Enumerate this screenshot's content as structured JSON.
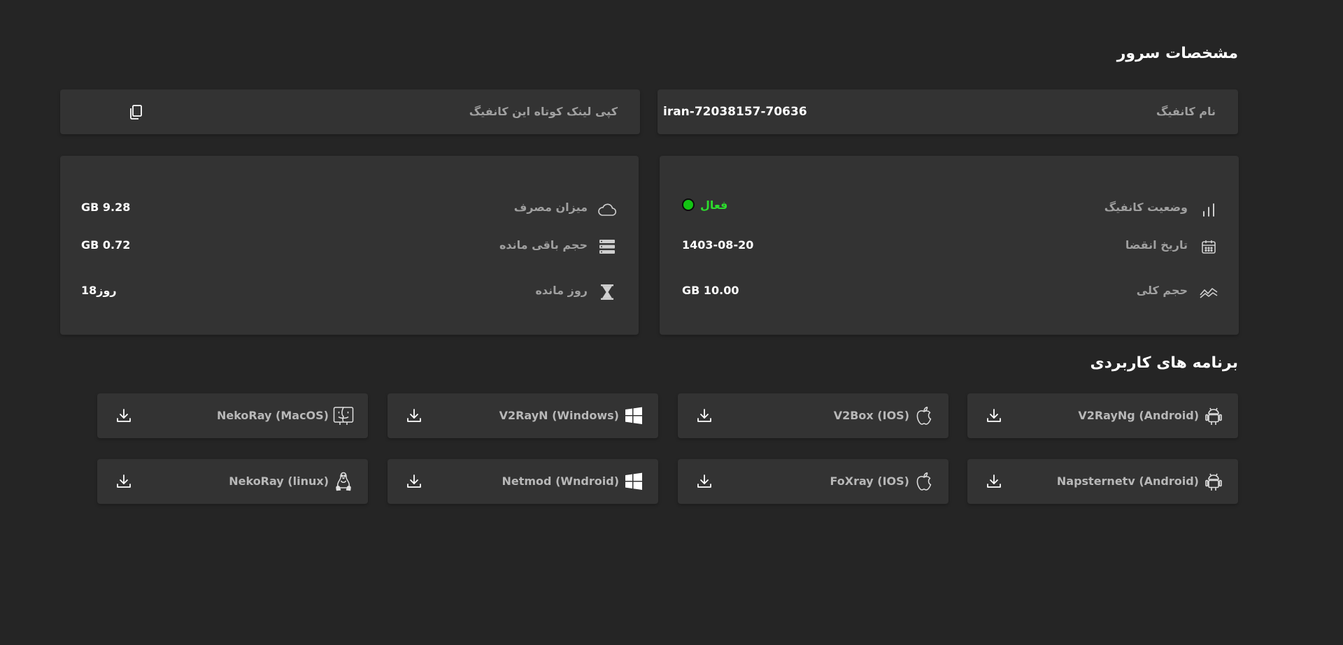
{
  "server_specs": {
    "title": "مشخصات سرور",
    "config_name_label": "نام کانفیگ",
    "config_name_value": "iran-72038157-70636",
    "copy_link_label": "کپی لینک کوتاه این کانفیگ"
  },
  "details": {
    "status_label": "وضعیت کانفیگ",
    "status_value": "فعال",
    "status_color": "#13c413",
    "expiry_label": "تاریخ انقضا",
    "expiry_value": "1403-08-20",
    "total_label": "حجم کلی",
    "total_value": "GB 10.00",
    "usage_label": "میزان مصرف",
    "usage_value": "GB 9.28",
    "remaining_label": "حجم باقی مانده",
    "remaining_value": "GB 0.72",
    "days_label": "روز مانده",
    "days_value": "18روز"
  },
  "apps": {
    "title": "برنامه های کاربردی",
    "items": [
      {
        "name": "V2RayNg (Android)",
        "os_icon": "android-icon"
      },
      {
        "name": "V2Box (IOS)",
        "os_icon": "apple-icon"
      },
      {
        "name": "V2RayN (Windows)",
        "os_icon": "windows-icon"
      },
      {
        "name": "NekoRay (MacOS)",
        "os_icon": "finder-icon"
      },
      {
        "name": "Napsternetv (Android)",
        "os_icon": "android-icon"
      },
      {
        "name": "FoXray (IOS)",
        "os_icon": "apple-icon"
      },
      {
        "name": "Netmod (Wndroid)",
        "os_icon": "windows-icon"
      },
      {
        "name": "NekoRay (linux)",
        "os_icon": "linux-icon"
      }
    ]
  },
  "colors": {
    "background": "#252525",
    "card": "#333333",
    "status_active": "#13c413"
  }
}
